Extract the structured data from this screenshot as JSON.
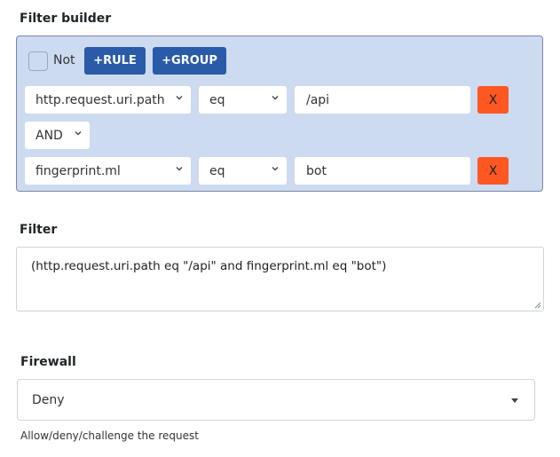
{
  "filter_builder": {
    "label": "Filter builder",
    "not_label": "Not",
    "not_checked": false,
    "add_rule_label": "+RULE",
    "add_group_label": "+GROUP",
    "rules": [
      {
        "field": "http.request.uri.path",
        "operator": "eq",
        "value": "/api",
        "remove_label": "X"
      },
      {
        "field": "fingerprint.ml",
        "operator": "eq",
        "value": "bot",
        "remove_label": "X"
      }
    ],
    "conjunction": "AND",
    "colors": {
      "panel_bg": "#cddbf1",
      "primary": "#2a5ba8",
      "danger": "#ff5722"
    }
  },
  "filter": {
    "label": "Filter",
    "value": "(http.request.uri.path eq \"/api\" and fingerprint.ml eq \"bot\")"
  },
  "firewall": {
    "label": "Firewall",
    "selected": "Deny",
    "help_text": "Allow/deny/challenge the request"
  }
}
